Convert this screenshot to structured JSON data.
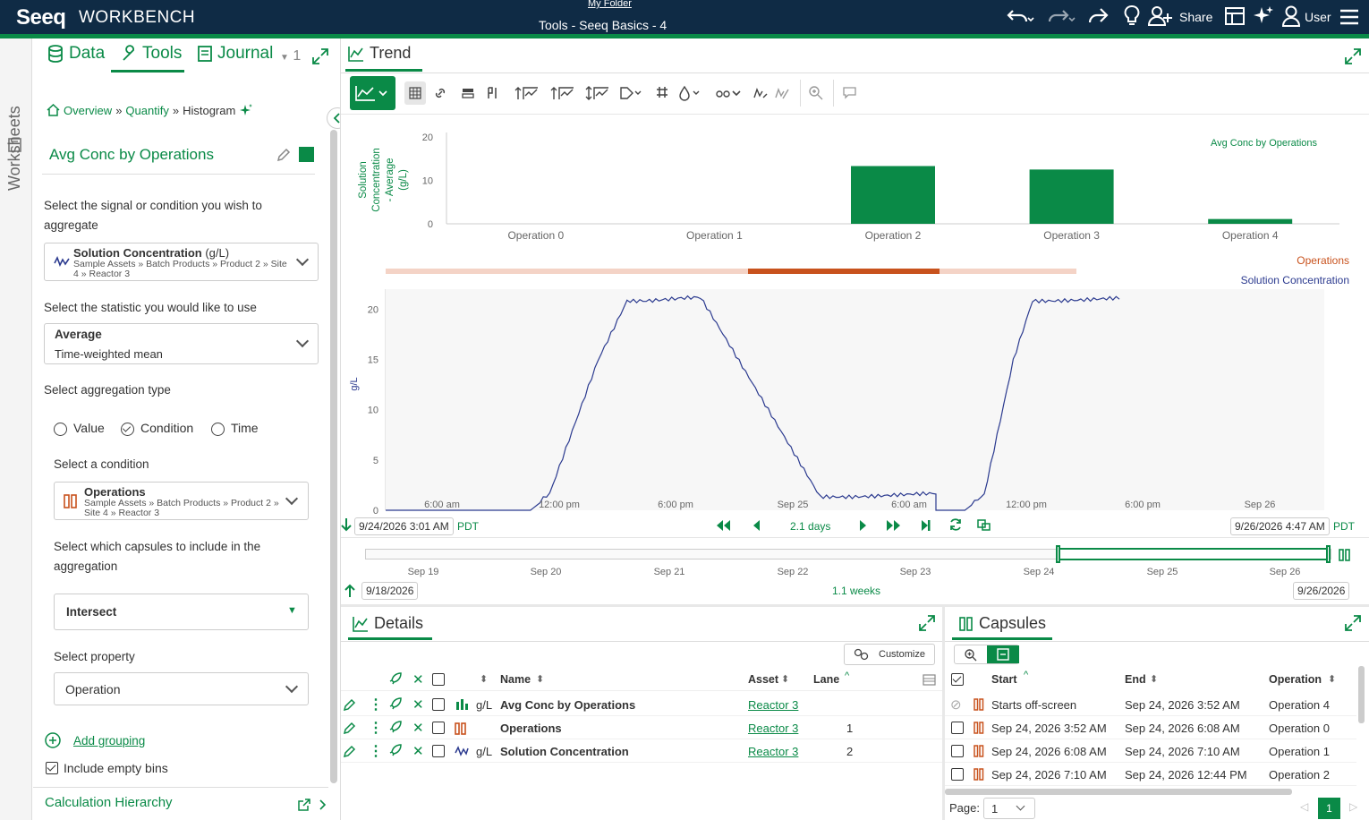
{
  "topbar": {
    "logo": "Seeq",
    "product": "WORKBENCH",
    "folder": "My Folder",
    "title": "Tools - Seeq Basics - 4",
    "share": "Share",
    "user": "User"
  },
  "left_rail": {
    "worksheets": "Worksheets"
  },
  "tabs": {
    "data": "Data",
    "tools": "Tools",
    "journal": "Journal",
    "count": "1"
  },
  "breadcrumb": {
    "overview": "Overview",
    "quantify": "Quantify",
    "histogram": "Histogram",
    "sep": "»"
  },
  "tool": {
    "title": "Avg Conc by Operations",
    "signal_prompt": "Select the signal or condition you wish to aggregate",
    "signal_name": "Solution Concentration",
    "signal_unit": "(g/L)",
    "signal_path": "Sample Assets » Batch Products » Product 2 » Site 4 » Reactor 3",
    "stat_prompt": "Select the statistic you would like to use",
    "stat_name": "Average",
    "stat_desc": "Time-weighted mean",
    "agg_prompt": "Select aggregation type",
    "agg_options": [
      "Value",
      "Condition",
      "Time"
    ],
    "cond_prompt": "Select a condition",
    "cond_name": "Operations",
    "cond_path": "Sample Assets » Batch Products » Product 2 » Site 4 » Reactor 3",
    "capsule_prompt": "Select which capsules to include in the aggregation",
    "capsule_mode": "Intersect",
    "property_prompt": "Select property",
    "property_value": "Operation",
    "add_grouping": "Add grouping",
    "include_empty": "Include empty bins",
    "calc_hierarchy": "Calculation Hierarchy"
  },
  "trend": {
    "tab": "Trend",
    "range_start": "9/24/2026 3:01 AM",
    "range_end": "9/26/2026 4:47 AM",
    "tz": "PDT",
    "duration": "2.1 days",
    "nav_start": "9/18/2026",
    "nav_end": "9/26/2026",
    "nav_duration": "1.1 weeks",
    "nav_ticks": [
      "Sep 19",
      "Sep 20",
      "Sep 21",
      "Sep 22",
      "Sep 23",
      "Sep 24",
      "Sep 25",
      "Sep 26"
    ],
    "time_ticks": [
      "6:00 am",
      "12:00 pm",
      "6:00 pm",
      "Sep 25",
      "6:00 am",
      "12:00 pm",
      "6:00 pm",
      "Sep 26"
    ],
    "lane_operations": "Operations",
    "lane_signal": "Solution Concentration"
  },
  "chart_data": [
    {
      "type": "bar",
      "categories": [
        "Operation 0",
        "Operation 1",
        "Operation 2",
        "Operation 3",
        "Operation 4"
      ],
      "values": [
        0,
        0,
        13.3,
        12.5,
        1.1
      ],
      "ylabel": "Solution Concentration - Average (g/L)",
      "ylabel_lines": [
        "Solution",
        "Concentration",
        "- Average",
        "(g/L)"
      ],
      "ylim": [
        0,
        20
      ],
      "yticks": [
        0,
        10,
        20
      ],
      "legend": "Avg Conc by Operations",
      "color": "#0a8a47"
    },
    {
      "type": "line",
      "series_name": "Solution Concentration",
      "ylabel": "g/L",
      "ylim": [
        0,
        22
      ],
      "yticks": [
        0,
        5,
        10,
        15,
        20
      ],
      "x_hours": [
        0,
        7.5,
        8.5,
        11,
        12.5,
        13,
        16.3,
        16.8,
        22.5,
        28.5,
        28.5,
        30,
        31,
        32.5,
        33.5,
        38
      ],
      "y": [
        0,
        0,
        1.5,
        15,
        21,
        21,
        21,
        19.5,
        1.5,
        1.5,
        0,
        0,
        1.5,
        15,
        21,
        21
      ],
      "color": "#2b3a8f"
    }
  ],
  "details": {
    "tab": "Details",
    "customize": "Customize",
    "columns": {
      "name": "Name",
      "asset": "Asset",
      "lane": "Lane"
    },
    "rows": [
      {
        "unit": "g/L",
        "name": "Avg Conc by Operations",
        "asset": "Reactor 3",
        "lane": ""
      },
      {
        "unit": "",
        "name": "Operations",
        "asset": "Reactor 3",
        "lane": "1"
      },
      {
        "unit": "g/L",
        "name": "Solution Concentration",
        "asset": "Reactor 3",
        "lane": "2"
      }
    ]
  },
  "capsules": {
    "tab": "Capsules",
    "columns": {
      "start": "Start",
      "end": "End",
      "operation": "Operation"
    },
    "rows": [
      {
        "start": "Starts off-screen",
        "end": "Sep 24, 2026 3:52 AM",
        "operation": "Operation 4"
      },
      {
        "start": "Sep 24, 2026 3:52 AM",
        "end": "Sep 24, 2026 6:08 AM",
        "operation": "Operation 0"
      },
      {
        "start": "Sep 24, 2026 6:08 AM",
        "end": "Sep 24, 2026 7:10 AM",
        "operation": "Operation 1"
      },
      {
        "start": "Sep 24, 2026 7:10 AM",
        "end": "Sep 24, 2026 12:44 PM",
        "operation": "Operation 2"
      }
    ],
    "page_label": "Page:",
    "page_value": "1",
    "page_current": "1"
  }
}
